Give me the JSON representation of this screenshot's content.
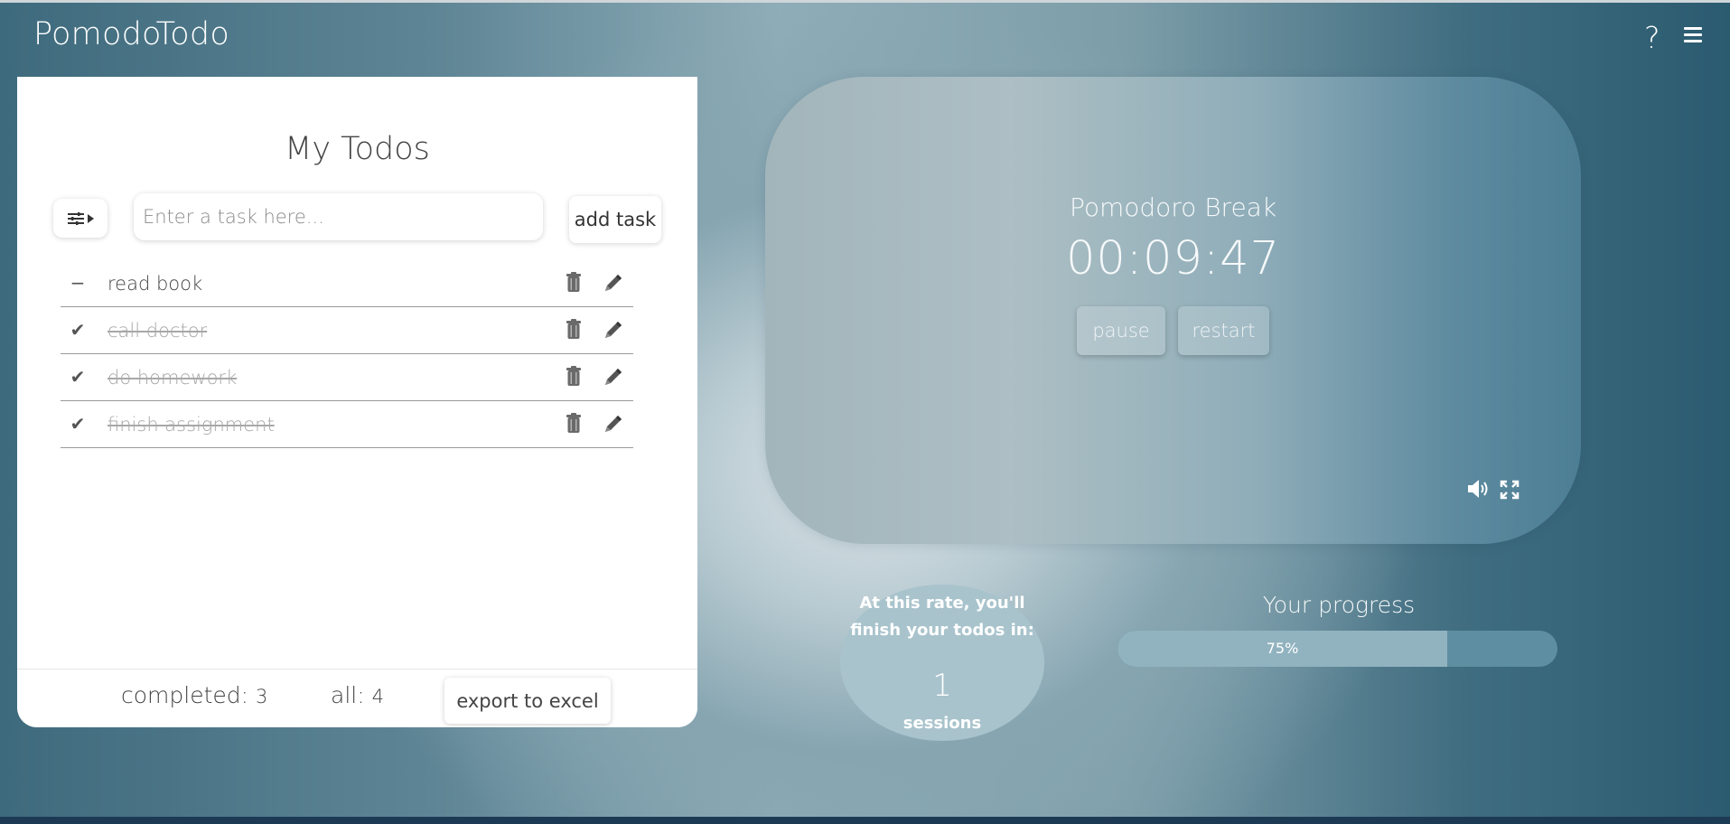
{
  "app": {
    "title": "PomodoTodo",
    "help_label": "?"
  },
  "todos": {
    "title": "My Todos",
    "input_placeholder": "Enter a task here...",
    "add_button": "add task",
    "items": [
      {
        "text": "read book",
        "completed": false,
        "status_glyph": "−"
      },
      {
        "text": "call doctor",
        "completed": true,
        "status_glyph": "✔"
      },
      {
        "text": "do homework",
        "completed": true,
        "status_glyph": "✔"
      },
      {
        "text": "finish assignment",
        "completed": true,
        "status_glyph": "✔"
      }
    ],
    "footer": {
      "completed_label": "completed:",
      "completed_count": "3",
      "all_label": "all:",
      "all_count": "4",
      "export_button": "export to excel"
    }
  },
  "timer": {
    "label": "Pomodoro Break",
    "time": "00:09:47",
    "pause_button": "pause",
    "restart_button": "restart"
  },
  "estimate": {
    "text": "At this rate, you'll finish your todos in:",
    "sessions": "1",
    "unit": "sessions"
  },
  "progress": {
    "title": "Your progress",
    "percent_label": "75%",
    "value": 0.75
  },
  "icons": {
    "filter": "sliders-icon",
    "trash": "trash-icon",
    "edit": "pencil-icon",
    "sound": "speaker-icon",
    "fullscreen": "expand-icon",
    "menu": "hamburger-icon"
  }
}
